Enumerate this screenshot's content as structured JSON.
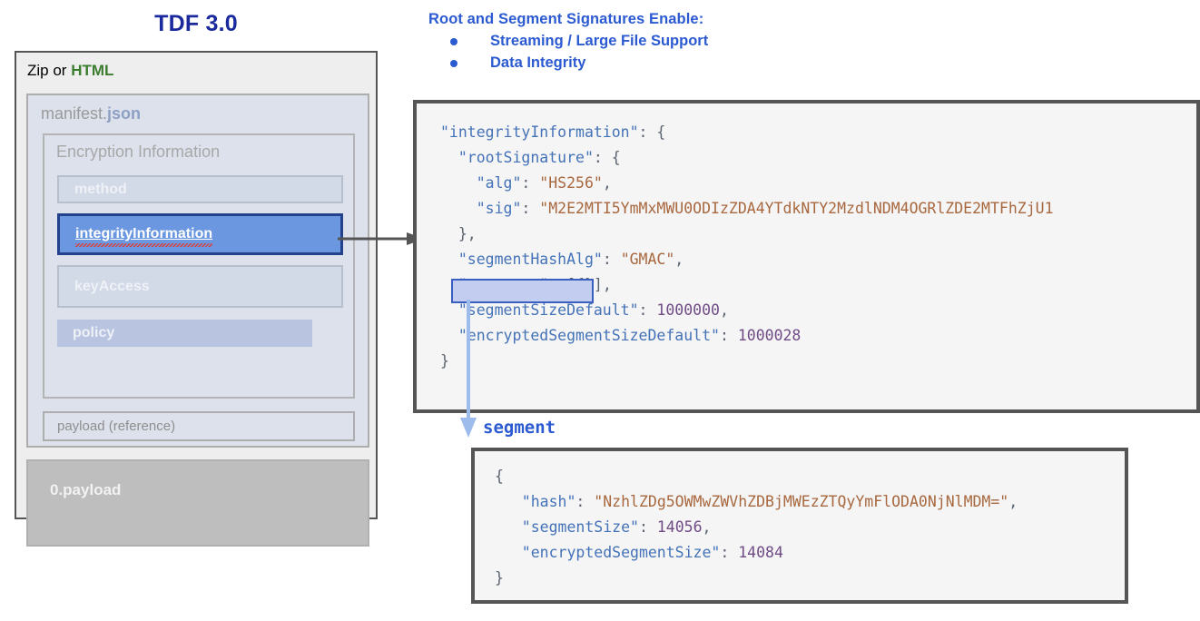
{
  "left_diagram": {
    "title": "TDF 3.0",
    "container_label_prefix": "Zip or ",
    "container_label_highlight": "HTML",
    "manifest_label_prefix": "manifest.",
    "manifest_label_highlight": "json",
    "encryption_information_label": "Encryption Information",
    "rows": [
      {
        "label": "method"
      },
      {
        "label": "integrityInformation"
      },
      {
        "label": "keyAccess"
      },
      {
        "label": "policy"
      }
    ],
    "payload_reference_label": "payload (reference)",
    "payload_label": "0.payload",
    "colors": {
      "title": "#1a2a9c",
      "html_green": "#3c7d30",
      "json_blue": "#8e9fc4",
      "selected_fill": "#6a97e0",
      "selected_border": "#24418c",
      "panel_bg": "#eeeeee",
      "manifest_bg": "#dce1ec",
      "payload_bg": "#bebebe"
    }
  },
  "callout": {
    "title": "Root and Segment Signatures Enable:",
    "items": [
      "Streaming / Large File Support",
      "Data Integrity"
    ],
    "color": "#2b5ad1"
  },
  "main_code": {
    "lines": [
      [
        {
          "t": "\"integrityInformation\"",
          "c": "k"
        },
        {
          "t": ": {",
          "c": "p"
        }
      ],
      [
        {
          "t": "  \"rootSignature\"",
          "c": "k"
        },
        {
          "t": ": {",
          "c": "p"
        }
      ],
      [
        {
          "t": "    \"alg\"",
          "c": "k"
        },
        {
          "t": ": ",
          "c": "p"
        },
        {
          "t": "\"HS256\"",
          "c": "s"
        },
        {
          "t": ",",
          "c": "p"
        }
      ],
      [
        {
          "t": "    \"sig\"",
          "c": "k"
        },
        {
          "t": ": ",
          "c": "p"
        },
        {
          "t": "\"M2E2MTI5YmMxMWU0ODIzZDA4YTdkNTY2MzdlNDM4OGRlZDE2MTFhZjU1",
          "c": "s"
        }
      ],
      [
        {
          "t": "  },",
          "c": "p"
        }
      ],
      [
        {
          "t": "  \"segmentHashAlg\"",
          "c": "k"
        },
        {
          "t": ": ",
          "c": "p"
        },
        {
          "t": "\"GMAC\"",
          "c": "s"
        },
        {
          "t": ",",
          "c": "p"
        }
      ],
      [
        {
          "t": "  \"segments\"",
          "c": "k"
        },
        {
          "t": ": [{}],",
          "c": "p"
        }
      ],
      [
        {
          "t": "  \"segmentSizeDefault\"",
          "c": "k"
        },
        {
          "t": ": ",
          "c": "p"
        },
        {
          "t": "1000000",
          "c": "n"
        },
        {
          "t": ",",
          "c": "p"
        }
      ],
      [
        {
          "t": "  \"encryptedSegmentSizeDefault\"",
          "c": "k"
        },
        {
          "t": ": ",
          "c": "p"
        },
        {
          "t": "1000028",
          "c": "n"
        }
      ],
      [
        {
          "t": "}",
          "c": "p"
        }
      ]
    ]
  },
  "segment_caption": "segment",
  "segment_code": {
    "lines": [
      [
        {
          "t": "{",
          "c": "p"
        }
      ],
      [
        {
          "t": "   \"hash\"",
          "c": "k"
        },
        {
          "t": ": ",
          "c": "p"
        },
        {
          "t": "\"NzhlZDg5OWMwZWVhZDBjMWEzZTQyYmFlODA0NjNlMDM=\"",
          "c": "s"
        },
        {
          "t": ",",
          "c": "p"
        }
      ],
      [
        {
          "t": "   \"segmentSize\"",
          "c": "k"
        },
        {
          "t": ": ",
          "c": "p"
        },
        {
          "t": "14056",
          "c": "n"
        },
        {
          "t": ",",
          "c": "p"
        }
      ],
      [
        {
          "t": "   \"encryptedSegmentSize\"",
          "c": "k"
        },
        {
          "t": ": ",
          "c": "p"
        },
        {
          "t": "14084",
          "c": "n"
        }
      ],
      [
        {
          "t": "}",
          "c": "p"
        }
      ]
    ]
  },
  "arrows": {
    "manifest_to_code": "arrow-right-dark",
    "segments_to_segment": "arrow-down-blue"
  }
}
